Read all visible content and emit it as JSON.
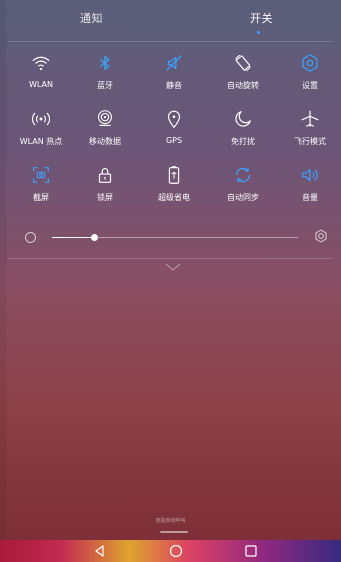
{
  "tabs": {
    "notifications": "通知",
    "switches": "开关",
    "active": "switches"
  },
  "tiles": [
    {
      "label": "WLAN",
      "icon": "wifi-icon",
      "active": false
    },
    {
      "label": "蓝牙",
      "icon": "bluetooth-icon",
      "active": true
    },
    {
      "label": "静音",
      "icon": "mute-icon",
      "active": true
    },
    {
      "label": "自动旋转",
      "icon": "rotate-icon",
      "active": false
    },
    {
      "label": "设置",
      "icon": "gear-icon",
      "active": true
    },
    {
      "label": "WLAN 热点",
      "icon": "hotspot-icon",
      "active": false
    },
    {
      "label": "移动数据",
      "icon": "mobile-data-icon",
      "active": false
    },
    {
      "label": "GPS",
      "icon": "location-icon",
      "active": false
    },
    {
      "label": "免打扰",
      "icon": "moon-icon",
      "active": false
    },
    {
      "label": "飞行模式",
      "icon": "airplane-icon",
      "active": false
    },
    {
      "label": "截屏",
      "icon": "screenshot-icon",
      "active": true
    },
    {
      "label": "锁屏",
      "icon": "lock-icon",
      "active": false
    },
    {
      "label": "超级省电",
      "icon": "battery-saver-icon",
      "active": false
    },
    {
      "label": "自动同步",
      "icon": "sync-icon",
      "active": true
    },
    {
      "label": "音量",
      "icon": "volume-icon",
      "active": true
    }
  ],
  "brightness": {
    "level": 0.17
  },
  "footer_hint": "双指滑动呼叫",
  "colors": {
    "active": "#3aa4ff",
    "inactive": "#ffffff"
  },
  "navbar": {
    "back": "back-icon",
    "home": "home-icon",
    "recent": "recent-apps-icon"
  }
}
